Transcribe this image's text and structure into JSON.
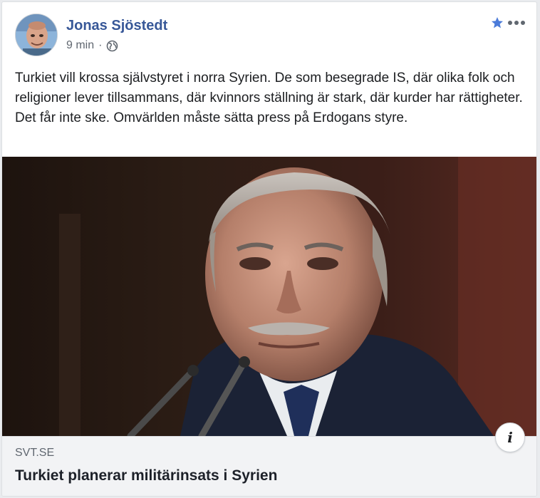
{
  "post": {
    "author": "Jonas Sjöstedt",
    "time": "9 min",
    "separator": "·",
    "audience_icon": "globe-icon",
    "text_lines": [
      "Turkiet vill krossa självstyret i norra Syrien. De som besegrade IS, där olika folk och religioner lever tillsammans, där kvinnors ställning är stark, där kurder har rättigheter.",
      "Det får inte ske. Omvärlden måste sätta press på Erdogans styre."
    ]
  },
  "actions": {
    "star_icon": "star-icon",
    "more_icon": "more-options-icon"
  },
  "link_preview": {
    "info_label": "i",
    "domain": "SVT.SE",
    "title": "Turkiet planerar militärinsats i Syrien"
  },
  "colors": {
    "author": "#385898",
    "star": "#4b7bd9",
    "meta": "#606770",
    "preview_bg": "#f2f3f5"
  }
}
